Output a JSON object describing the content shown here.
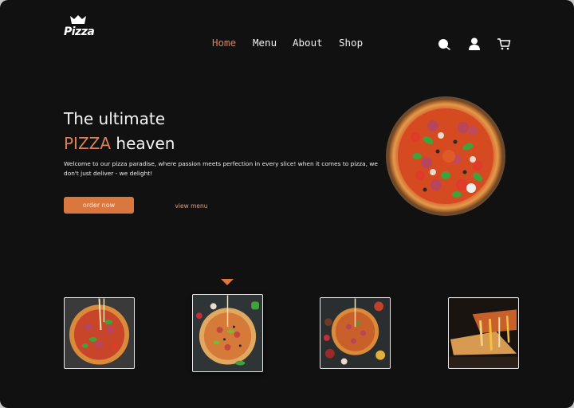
{
  "brand": {
    "logo_text": "Pizza",
    "logo_icon": "crown-icon"
  },
  "nav": {
    "items": [
      {
        "label": "Home",
        "active": true
      },
      {
        "label": "Menu",
        "active": false
      },
      {
        "label": "About",
        "active": false
      },
      {
        "label": "Shop",
        "active": false
      }
    ],
    "icons": [
      "search-icon",
      "user-icon",
      "cart-icon"
    ]
  },
  "hero": {
    "title_line1": "The ultimate",
    "title_accent": "PIZZA",
    "title_line2_rest": " heaven",
    "description": "Welcome to our pizza paradise, where passion meets perfection in every slice! when it comes to pizza, we don't just deliver - we delight!",
    "primary_button": "order now",
    "secondary_button": "view menu",
    "image": "pizza-top-view-image"
  },
  "gallery": {
    "selected_index": 1,
    "items": [
      {
        "name": "pizza-cheese-pull-thumbnail"
      },
      {
        "name": "pizza-ingredients-falling-thumbnail"
      },
      {
        "name": "pizza-with-ingredients-thumbnail"
      },
      {
        "name": "pizza-slice-cheese-thumbnail"
      }
    ]
  },
  "colors": {
    "accent": "#d9773f",
    "background": "#111111",
    "text": "#f4f4f4"
  }
}
